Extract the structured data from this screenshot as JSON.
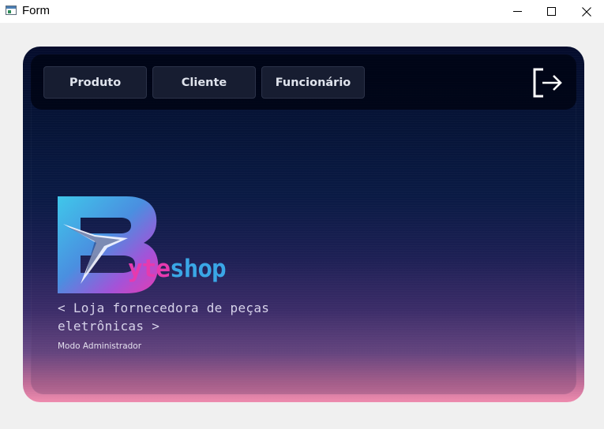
{
  "window": {
    "title": "Form",
    "controls": [
      "minimize",
      "maximize",
      "close"
    ]
  },
  "nav": {
    "buttons": [
      {
        "label": "Produto"
      },
      {
        "label": "Cliente"
      },
      {
        "label": "Funcionário"
      }
    ],
    "logout_icon": "logout-icon"
  },
  "brand": {
    "logo_letter": "B",
    "name_part1": "yte",
    "name_part2": "shop",
    "tagline": "< Loja fornecedora de peças eletrônicas >",
    "mode": "Modo Administrador"
  },
  "colors": {
    "accent_pink": "#e63aaf",
    "accent_blue": "#3aa7e6",
    "panel_top": "#050c2c",
    "panel_bottom": "#ee8bae"
  }
}
